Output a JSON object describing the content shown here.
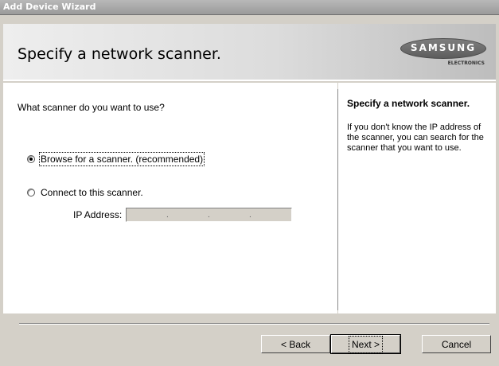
{
  "window": {
    "title": "Add Device Wizard"
  },
  "header": {
    "title": "Specify a network scanner.",
    "logo_word": "SAMSUNG",
    "logo_sub": "ELECTRONICS"
  },
  "main": {
    "question": "What scanner do you want to use?",
    "options": [
      {
        "label": "Browse for a scanner. (recommended)",
        "selected": true
      },
      {
        "label": "Connect to this scanner.",
        "selected": false
      }
    ],
    "ip_label": "IP Address:",
    "ip_value": ". . ."
  },
  "side": {
    "title": "Specify a network scanner.",
    "description": "If you don't know the IP address of the scanner, you can search for the scanner that you want to use."
  },
  "buttons": {
    "back": "< Back",
    "next": "Next >",
    "cancel": "Cancel"
  }
}
